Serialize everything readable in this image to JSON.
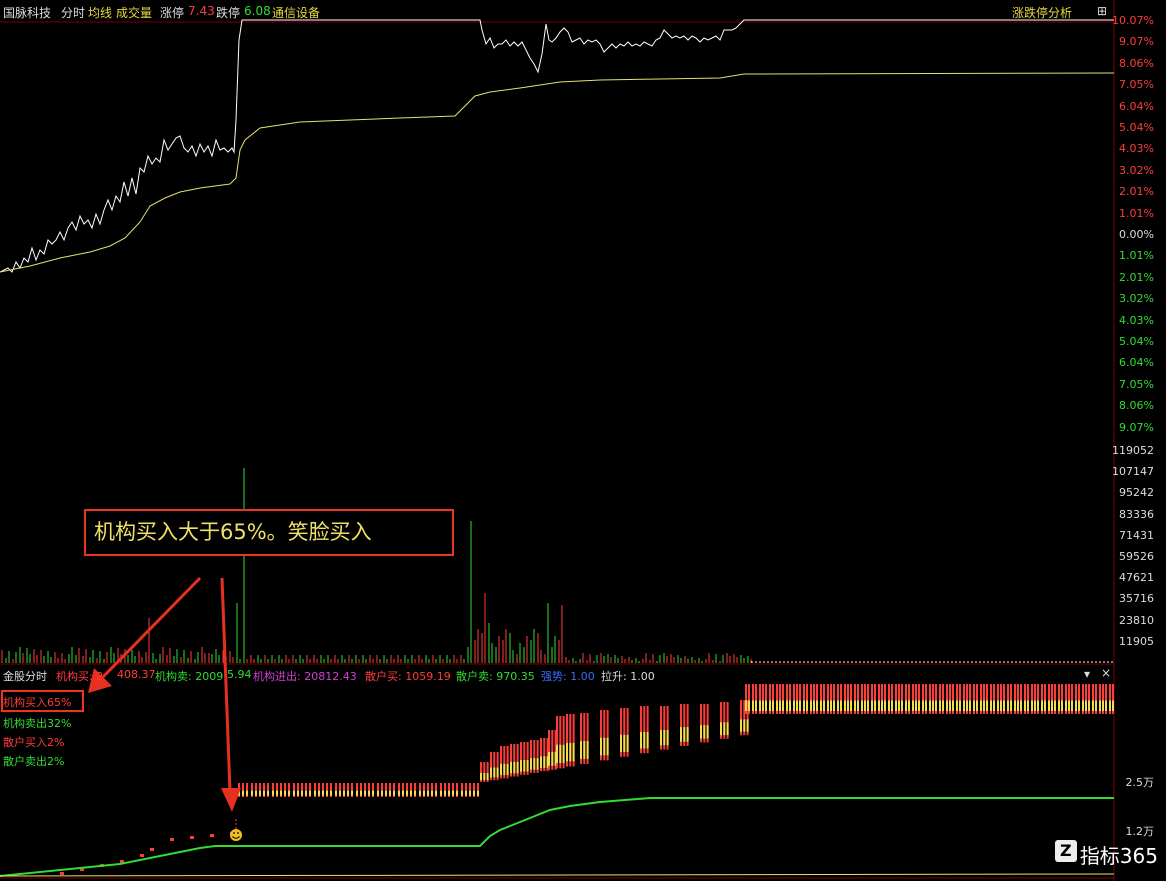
{
  "header": {
    "stock_name": "国脉科技",
    "tab_minute": "分时",
    "avg_line_label": "均线",
    "volume_label": "成交量",
    "limit_up_label": "涨停",
    "limit_up_value": "7.43",
    "limit_down_label": "跌停",
    "limit_down_value": "6.08",
    "sector": "通信设备",
    "analysis_button": "涨跌停分析",
    "zoom_button": "⊞"
  },
  "pct_axis": [
    "10.07%",
    "9.07%",
    "8.06%",
    "7.05%",
    "6.04%",
    "5.04%",
    "4.03%",
    "3.02%",
    "2.01%",
    "1.01%",
    "0.00%",
    "1.01%",
    "2.01%",
    "3.02%",
    "4.03%",
    "5.04%",
    "6.04%",
    "7.05%",
    "8.06%",
    "9.07%"
  ],
  "vol_axis": [
    "119052",
    "107147",
    "95242",
    "83336",
    "71431",
    "59526",
    "47621",
    "35716",
    "23810",
    "11905"
  ],
  "indicator": {
    "name": "金股分时",
    "inst_buy": "机构买: 2",
    "inst_buy_value": "408.37",
    "inst_sell": "机构卖: 2009",
    "inst_sell_value": "5.94",
    "inst_net": "机构进出: 20812.43",
    "retail_buy": "散户买: 1059.19",
    "retail_sell": "散户卖: 970.35",
    "strength": "强势: 1.00",
    "pull": "拉升: 1.00",
    "menu_symbol": "▾",
    "close_symbol": "×"
  },
  "legend": {
    "inst_buy_pct": "机构买入65%",
    "inst_sell_pct": "机构卖出32%",
    "retail_buy_pct": "散户买入2%",
    "retail_sell_pct": "散户卖出2%"
  },
  "ind_axis": [
    "2.5万",
    "1.2万"
  ],
  "callout_text": "机构买入大于65%。笑脸买入",
  "watermark_text": "指标365",
  "watermark_logo": "Z",
  "colors": {
    "up": "#ff3c3c",
    "down": "#32dc32",
    "price_line": "#ffffff",
    "avg_line": "#e8e070",
    "label_yellow": "#e8d840",
    "callout": "#e83020"
  }
}
